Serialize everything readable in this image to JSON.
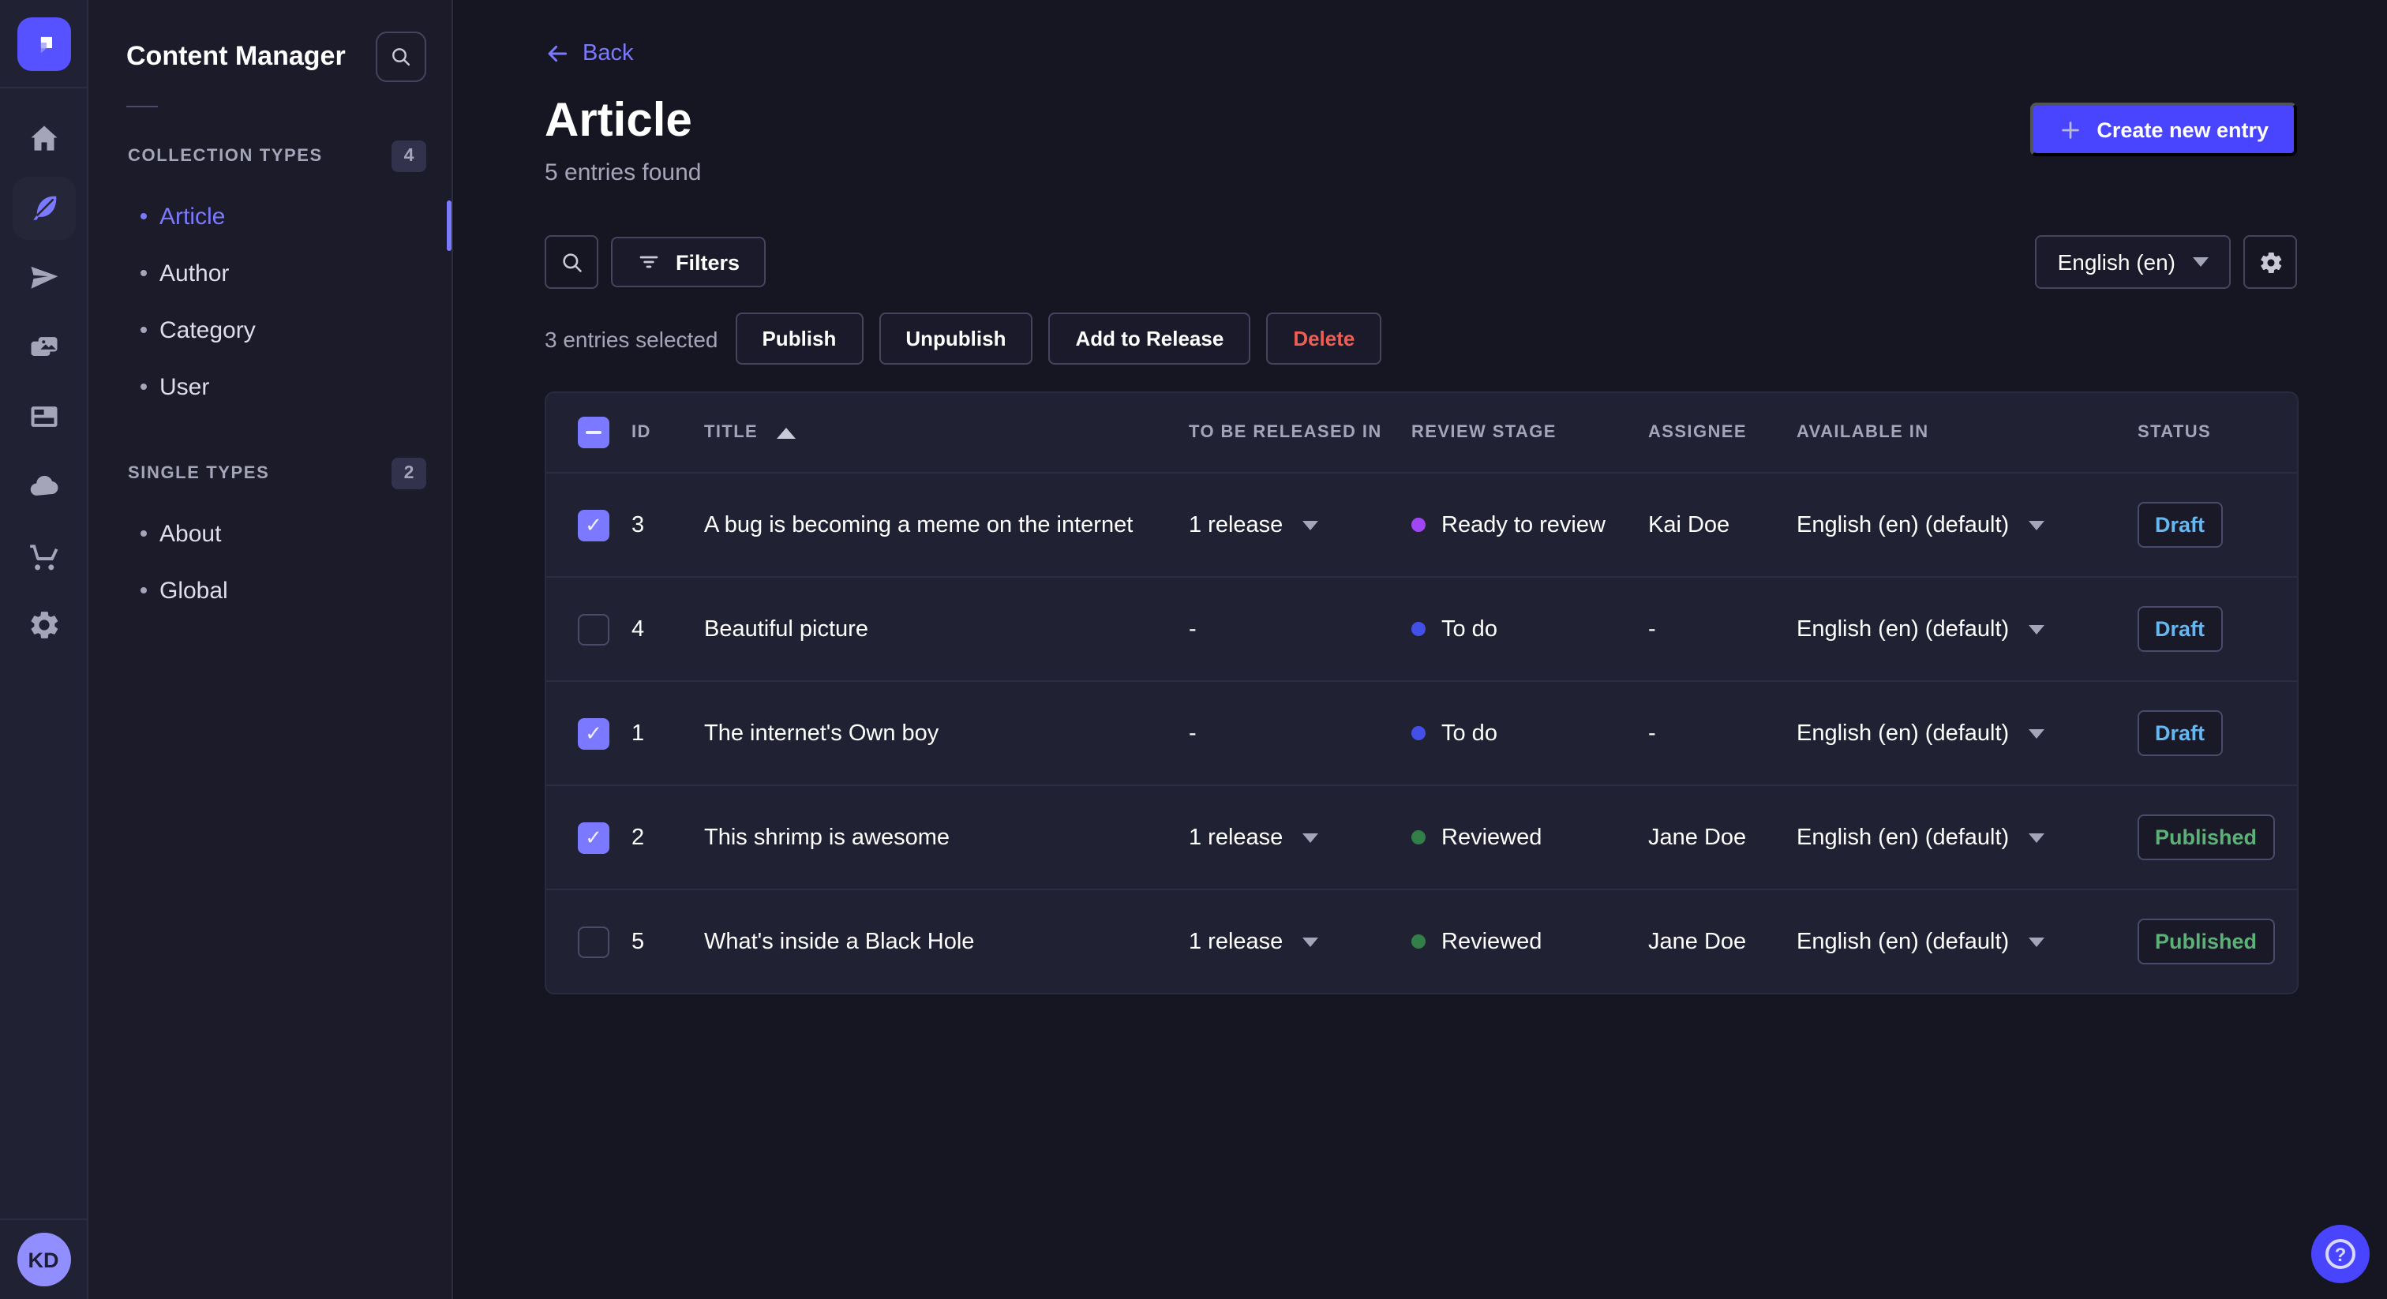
{
  "app": {
    "brand_color": "#4945ff",
    "accent_color": "#7b79ff",
    "avatar_initials": "KD"
  },
  "icon_sidebar": {
    "items": [
      {
        "icon": "home-icon",
        "active": false
      },
      {
        "icon": "content-manager-feather-icon",
        "active": true
      },
      {
        "icon": "releases-paper-plane-icon",
        "active": false
      },
      {
        "icon": "media-library-pictures-icon",
        "active": false
      },
      {
        "icon": "content-type-builder-layout-icon",
        "active": false
      },
      {
        "icon": "deploy-cloud-icon",
        "active": false
      },
      {
        "icon": "marketplace-cart-icon",
        "active": false
      },
      {
        "icon": "settings-gear-icon",
        "active": false
      }
    ]
  },
  "subnav": {
    "title": "Content Manager",
    "search_icon": "search-icon",
    "sections": [
      {
        "label": "COLLECTION TYPES",
        "count": "4",
        "items": [
          {
            "label": "Article",
            "active": true
          },
          {
            "label": "Author",
            "active": false
          },
          {
            "label": "Category",
            "active": false
          },
          {
            "label": "User",
            "active": false
          }
        ]
      },
      {
        "label": "SINGLE TYPES",
        "count": "2",
        "items": [
          {
            "label": "About",
            "active": false
          },
          {
            "label": "Global",
            "active": false
          }
        ]
      }
    ]
  },
  "header": {
    "back_label": "Back",
    "title": "Article",
    "subtitle": "5 entries found",
    "create_button_label": "Create new entry"
  },
  "toolbar": {
    "search_icon": "search-icon",
    "filters_label": "Filters",
    "locale_value": "English (en)",
    "settings_icon": "gear-icon"
  },
  "selection": {
    "text": "3 entries selected",
    "publish_label": "Publish",
    "unpublish_label": "Unpublish",
    "add_to_release_label": "Add to Release",
    "delete_label": "Delete",
    "delete_color": "#ee5e52"
  },
  "table": {
    "headers": {
      "id": "ID",
      "title": "TITLE",
      "release": "TO BE RELEASED IN",
      "stage": "REVIEW STAGE",
      "assignee": "ASSIGNEE",
      "available": "AVAILABLE IN",
      "status": "STATUS"
    },
    "sort": {
      "column": "TITLE",
      "direction": "ascending"
    },
    "status_colors": {
      "draft": "#66b7f1",
      "published": "#5cb176"
    },
    "rows": [
      {
        "checked": true,
        "id": "3",
        "title": "A bug is becoming a meme on the internet",
        "release": "1 release",
        "release_caret": true,
        "stage": "Ready to review",
        "stage_color": "#a046f5",
        "assignee": "Kai Doe",
        "available": "English (en) (default)",
        "status": "Draft",
        "status_color": "#66b7f1"
      },
      {
        "checked": false,
        "id": "4",
        "title": "Beautiful picture",
        "release": "-",
        "release_caret": false,
        "stage": "To do",
        "stage_color": "#4250e8",
        "assignee": "-",
        "available": "English (en) (default)",
        "status": "Draft",
        "status_color": "#66b7f1"
      },
      {
        "checked": true,
        "id": "1",
        "title": "The internet's Own boy",
        "release": "-",
        "release_caret": false,
        "stage": "To do",
        "stage_color": "#4250e8",
        "assignee": "-",
        "available": "English (en) (default)",
        "status": "Draft",
        "status_color": "#66b7f1"
      },
      {
        "checked": true,
        "id": "2",
        "title": "This shrimp is awesome",
        "release": "1 release",
        "release_caret": true,
        "stage": "Reviewed",
        "stage_color": "#328048",
        "assignee": "Jane Doe",
        "available": "English (en) (default)",
        "status": "Published",
        "status_color": "#5cb176"
      },
      {
        "checked": false,
        "id": "5",
        "title": "What's inside a Black Hole",
        "release": "1 release",
        "release_caret": true,
        "stage": "Reviewed",
        "stage_color": "#328048",
        "assignee": "Jane Doe",
        "available": "English (en) (default)",
        "status": "Published",
        "status_color": "#5cb176"
      }
    ]
  },
  "help": {
    "label": "?",
    "icon": "question-mark-icon"
  }
}
